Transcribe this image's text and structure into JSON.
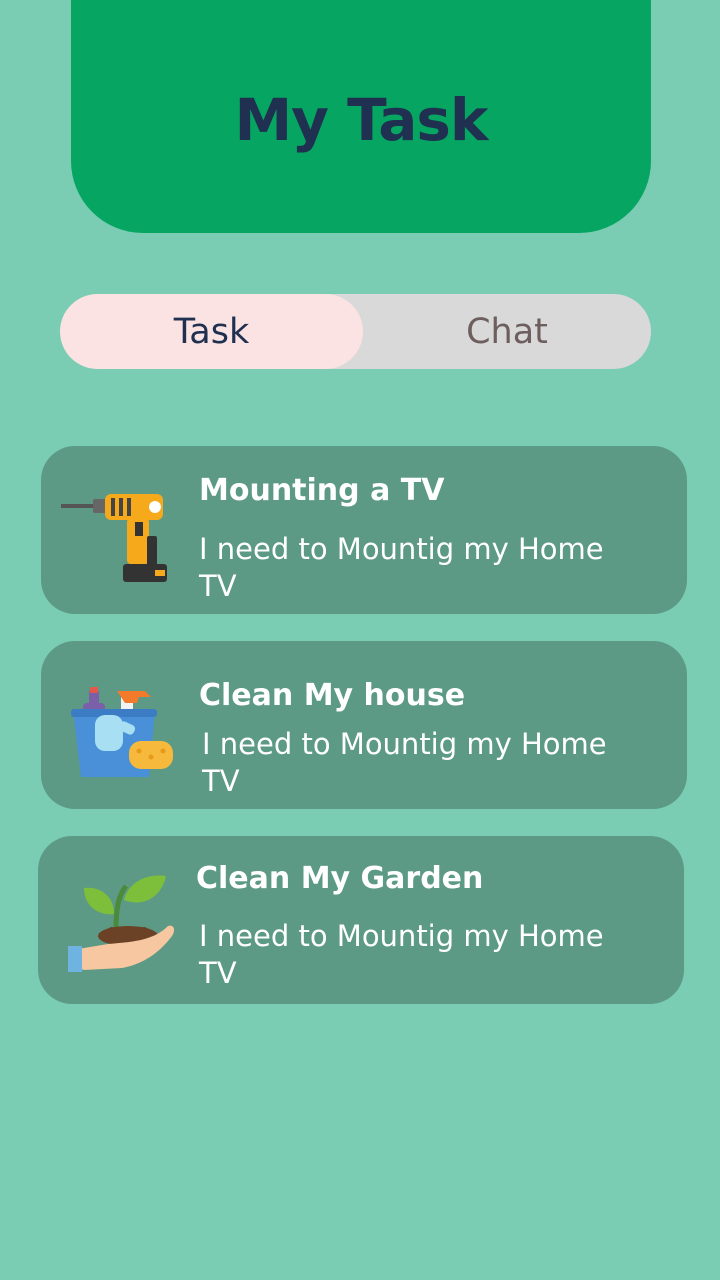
{
  "header": {
    "title": "My Task"
  },
  "tabs": [
    {
      "label": "Task",
      "active": true
    },
    {
      "label": "Chat",
      "active": false
    }
  ],
  "tasks": [
    {
      "title": "Mounting a TV",
      "description": "I need to Mountig my Home TV",
      "icon": "drill-icon"
    },
    {
      "title": "Clean My house",
      "description": "I need to Mountig my Home TV",
      "icon": "cleaning-bucket-icon"
    },
    {
      "title": "Clean My Garden",
      "description": "I need to Mountig my Home TV",
      "icon": "plant-in-hand-icon"
    }
  ],
  "colors": {
    "background": "#7acdb3",
    "header": "#06a561",
    "header_text": "#1f3050",
    "tab_active": "#fbe3e3",
    "tab_inactive": "#d9d9d9",
    "card": "#5c9a86"
  }
}
